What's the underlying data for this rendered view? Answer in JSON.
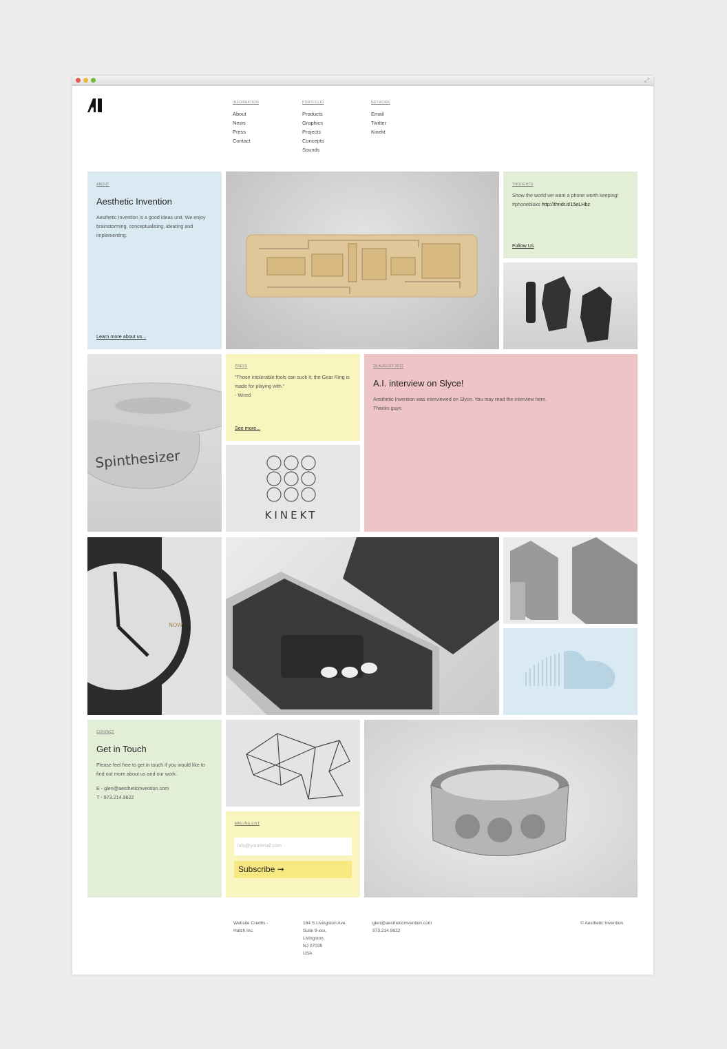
{
  "colors": {
    "blue": "#d9eaf2",
    "yellow": "#f9f5bf",
    "pink": "#efc4c6",
    "green": "#e3eed6"
  },
  "nav": {
    "information": {
      "head": "INFORMATION",
      "items": [
        "About",
        "News",
        "Press",
        "Contact"
      ]
    },
    "portfolio": {
      "head": "PORTFOLIO",
      "items": [
        "Products",
        "Graphics",
        "Projects",
        "Concepts",
        "Sounds"
      ]
    },
    "network": {
      "head": "NETWORK",
      "items": [
        "Email",
        "Twitter",
        "Kinekt"
      ]
    }
  },
  "about": {
    "label": "ABOUT",
    "title": "Aesthetic Invention",
    "text": "Aesthetic Invention is a good ideas unit. We enjoy brainstorming, conceptualising, ideating and implementing.",
    "link": "Learn more about us..."
  },
  "thoughts": {
    "label": "THOUGHTS",
    "text": "Show the world we want a phone worth keeping! #phonebloks ",
    "url": "http://thndr.it/15eLHbz",
    "link": "Follow Us"
  },
  "press": {
    "label": "PRESS",
    "quote": "\"Those intolerable fools can suck it; the Gear Ring is made for playing with.\"",
    "source": "- Wired",
    "link": "See more..."
  },
  "news": {
    "label": "28 AUGUST 2013",
    "title": "A.I. interview on Slyce!",
    "text": "Aesthetic Invention was interviewed on Slyce. You may read the interview here.",
    "text2": "Thanks guys."
  },
  "kinekt": {
    "word": "KINEKT"
  },
  "spin": {
    "word": "Spinthesizer"
  },
  "watch": {
    "word": "NOW"
  },
  "contact": {
    "label": "CONTACT",
    "title": "Get in Touch",
    "text": "Please feel free to get in touch if you would like to find out more about us and our work.",
    "email": "E - glen@aestheticinvention.com",
    "phone": "T - 973.214.9622"
  },
  "mailing": {
    "label": "MAILING LIST",
    "placeholder": "info@youremail.com",
    "button": "Subscribe ➞"
  },
  "footer": {
    "credits": [
      "Website Credits -",
      "Hatch Inc."
    ],
    "address": [
      "184 S.Livingston Ave.",
      "Suite 9-xxx,",
      "Livingston,",
      "NJ 07039",
      "USA"
    ],
    "contact": [
      "glen@aestheticinvention.com",
      "973.214.9622"
    ],
    "copyright": "© Aesthetic Invention"
  }
}
